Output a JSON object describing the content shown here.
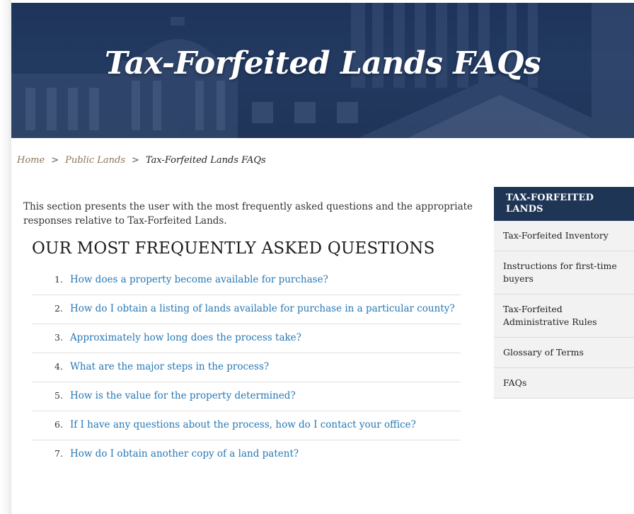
{
  "banner": {
    "title": "Tax-Forfeited Lands FAQs"
  },
  "breadcrumb": {
    "items": [
      {
        "label": "Home"
      },
      {
        "label": "Public Lands"
      }
    ],
    "separator": ">",
    "current": "Tax-Forfeited Lands FAQs"
  },
  "intro": {
    "text": "This section presents the user with the most frequently asked questions and the appropriate responses relative to Tax-Forfeited Lands."
  },
  "faq": {
    "heading": "OUR MOST FREQUENTLY ASKED QUESTIONS",
    "items": [
      {
        "num": "1.",
        "label": "How does a property become available for purchase?"
      },
      {
        "num": "2.",
        "label": "How do I obtain a listing of lands available for purchase in a particular county?"
      },
      {
        "num": "3.",
        "label": "Approximately how long does the process take?"
      },
      {
        "num": "4.",
        "label": "What are the major steps in the process?"
      },
      {
        "num": "5.",
        "label": "How is the value for the property determined?"
      },
      {
        "num": "6.",
        "label": "If I have any questions about the process, how do I contact your office?"
      },
      {
        "num": "7.",
        "label": "How do I obtain another copy of a land patent?"
      }
    ]
  },
  "sidebar": {
    "header": "TAX-FORFEITED LANDS",
    "items": [
      {
        "label": "Tax-Forfeited Inventory"
      },
      {
        "label": "Instructions for first-time buyers"
      },
      {
        "label": "Tax-Forfeited Administrative Rules"
      },
      {
        "label": "Glossary of Terms"
      },
      {
        "label": "FAQs"
      }
    ]
  },
  "colors": {
    "banner_navy": "#223659",
    "link_blue": "#2678b5",
    "breadcrumb_link": "#8a7355",
    "sidebar_header": "#1f3556",
    "sidebar_item_bg": "#f2f2f2"
  }
}
